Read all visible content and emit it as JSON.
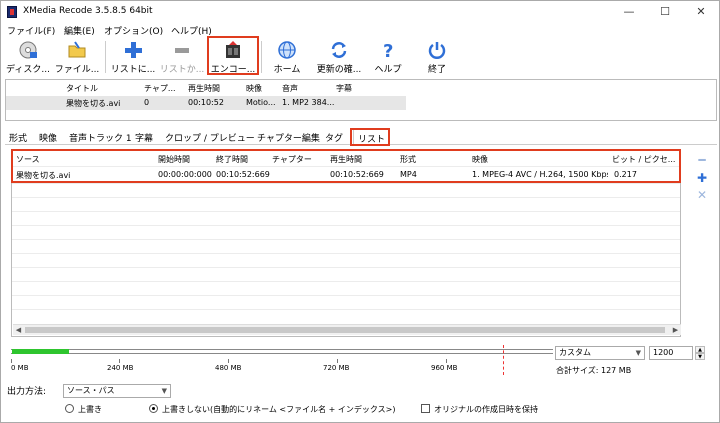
{
  "window": {
    "title": "XMedia Recode 3.5.8.5 64bit",
    "controls": {
      "minimize": "—",
      "maximize": "☐",
      "close": "✕"
    }
  },
  "menu": [
    "ファイル(F)",
    "編集(E)",
    "オプション(O)",
    "ヘルプ(H)"
  ],
  "toolbar": {
    "items": [
      {
        "label": "ディスク...",
        "icon": "disc-icon",
        "enabled": true
      },
      {
        "label": "ファイル...",
        "icon": "folder-icon",
        "enabled": true
      },
      {
        "label": "リストに...",
        "icon": "plus-icon",
        "enabled": true
      },
      {
        "label": "リストか...",
        "icon": "minus-icon",
        "enabled": false
      },
      {
        "label": "エンコー...",
        "icon": "encode-icon",
        "enabled": true,
        "highlighted": true
      },
      {
        "label": "ホーム",
        "icon": "globe-icon",
        "enabled": true
      },
      {
        "label": "更新の確...",
        "icon": "refresh-icon",
        "enabled": true
      },
      {
        "label": "ヘルプ",
        "icon": "help-icon",
        "enabled": true
      },
      {
        "label": "終了",
        "icon": "power-icon",
        "enabled": true
      }
    ]
  },
  "file_list": {
    "columns": [
      "タイトル",
      "チャプ...",
      "再生時間",
      "映像",
      "音声",
      "字幕"
    ],
    "rows": [
      {
        "title": "果物を切る.avi",
        "chapters": "0",
        "duration": "00:10:52",
        "video": "Motio...",
        "audio": "1. MP2 384...",
        "subtitles": ""
      }
    ]
  },
  "tabs": [
    {
      "label": "形式",
      "active": false
    },
    {
      "label": "映像",
      "active": false
    },
    {
      "label": "音声トラック 1",
      "active": false
    },
    {
      "label": "字幕",
      "active": false
    },
    {
      "label": "クロップ / プレビュー",
      "active": false
    },
    {
      "label": "チャプター編集",
      "active": false
    },
    {
      "label": "タグ",
      "active": false
    },
    {
      "label": "リスト",
      "active": true
    }
  ],
  "job_list": {
    "columns": [
      "ソース",
      "開始時間",
      "終了時間",
      "チャプター",
      "再生時間",
      "形式",
      "映像",
      "ビット / ピクセ..."
    ],
    "rows": [
      {
        "source": "果物を切る.avi",
        "start": "00:00:00:000",
        "end": "00:10:52:669",
        "chapter": "",
        "duration": "00:10:52:669",
        "format": "MP4",
        "video": "1. MPEG-4 AVC / H.264, 1500 Kbps, ...",
        "bits_per_pixel": "0.217"
      }
    ]
  },
  "side_buttons": {
    "remove": "━",
    "add": "✚",
    "clear": "✕"
  },
  "capacity": {
    "used_fraction": 0.105,
    "ticks": [
      "0 MB",
      "240 MB",
      "480 MB",
      "720 MB",
      "960 MB"
    ],
    "target_select": "カスタム",
    "target_value": "1200",
    "total_size": "合計サイズ: 127 MB"
  },
  "output": {
    "label": "出力方法:",
    "method_select": "ソース・パス",
    "options": [
      {
        "label": "上書き",
        "selected": false
      },
      {
        "label": "上書きしない(自動的にリネーム <ファイル名 + インデックス>)",
        "selected": true
      }
    ],
    "keep_date_label": "オリジナルの作成日時を保持",
    "keep_date_checked": false
  },
  "colors": {
    "highlight": "#e03c1e",
    "progress": "#2ec52e",
    "accent": "#2f6fd6"
  }
}
